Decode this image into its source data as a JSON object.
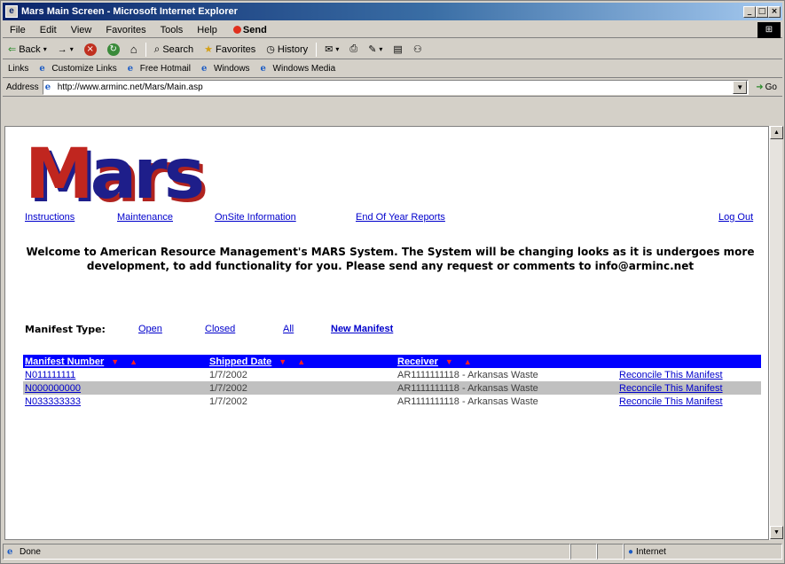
{
  "window": {
    "title": "Mars Main Screen - Microsoft Internet Explorer",
    "controls": [
      "_",
      "□",
      "×"
    ]
  },
  "menu": {
    "items": [
      "File",
      "Edit",
      "View",
      "Favorites",
      "Tools",
      "Help"
    ],
    "send_label": "Send"
  },
  "toolbar": {
    "back": "Back",
    "forward": "→",
    "search": "Search",
    "favorites": "Favorites",
    "history": "History"
  },
  "links_bar": {
    "label": "Links",
    "items": [
      "Customize Links",
      "Free Hotmail",
      "Windows",
      "Windows Media"
    ]
  },
  "address": {
    "label": "Address",
    "url": "http://www.arminc.net/Mars/Main.asp",
    "go_label": "Go"
  },
  "page": {
    "logo_text_m": "M",
    "logo_text_rest": "ars",
    "nav": {
      "instructions": "Instructions",
      "maintenance": "Maintenance",
      "onsite": "OnSite Information",
      "eoy": "End Of Year Reports",
      "logout": "Log Out"
    },
    "welcome": "Welcome to American Resource Management's MARS System. The System will be changing looks as it is undergoes more development, to add functionality for you. Please send any request or comments to info@arminc.net",
    "manifest_type": {
      "label": "Manifest Type:",
      "open": "Open",
      "closed": "Closed",
      "all": "All",
      "new": "New Manifest"
    },
    "table": {
      "headers": {
        "number": "Manifest Number",
        "shipped": "Shipped Date",
        "receiver": "Receiver"
      },
      "rows": [
        {
          "number": "N011111111",
          "shipped": "1/7/2002",
          "receiver": "AR1111111118 - Arkansas Waste",
          "action": "Reconcile This Manifest"
        },
        {
          "number": "N000000000",
          "shipped": "1/7/2002",
          "receiver": "AR1111111118 - Arkansas Waste",
          "action": "Reconcile This Manifest"
        },
        {
          "number": "N033333333",
          "shipped": "1/7/2002",
          "receiver": "AR1111111118 - Arkansas Waste",
          "action": "Reconcile This Manifest"
        }
      ]
    }
  },
  "status": {
    "text": "Done",
    "zone": "Internet"
  },
  "colors": {
    "header_bg": "#0000ff",
    "link": "#0000cc",
    "sort_arrow": "#ff2020",
    "alt_row": "#c0c0c0"
  }
}
